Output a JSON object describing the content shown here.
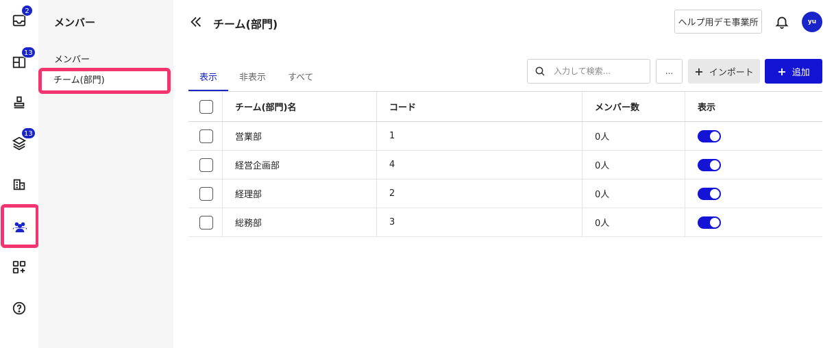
{
  "rail": {
    "badges": {
      "inbox": "2",
      "board": "13",
      "layers": "13"
    }
  },
  "subnav": {
    "title": "メンバー",
    "items": [
      {
        "label": "メンバー"
      },
      {
        "label": "チーム(部門)"
      }
    ]
  },
  "header": {
    "title": "チーム(部門)",
    "help_button": "ヘルプ用デモ事業所",
    "avatar_initials": "yu"
  },
  "tabs": [
    {
      "label": "表示",
      "active": true
    },
    {
      "label": "非表示",
      "active": false
    },
    {
      "label": "すべて",
      "active": false
    }
  ],
  "toolbar": {
    "search_placeholder": "入力して検索...",
    "more_label": "...",
    "import_label": "インポート",
    "add_label": "追加"
  },
  "table": {
    "columns": [
      "チーム(部門)名",
      "コード",
      "メンバー数",
      "表示"
    ],
    "rows": [
      {
        "name": "営業部",
        "code": "1",
        "members": "0人",
        "shown": true
      },
      {
        "name": "経営企画部",
        "code": "4",
        "members": "0人",
        "shown": true
      },
      {
        "name": "経理部",
        "code": "2",
        "members": "0人",
        "shown": true
      },
      {
        "name": "総務部",
        "code": "3",
        "members": "0人",
        "shown": true
      }
    ]
  },
  "colors": {
    "accent": "#1a25c9",
    "primary_button": "#1414d6",
    "highlight": "#f2346f"
  }
}
